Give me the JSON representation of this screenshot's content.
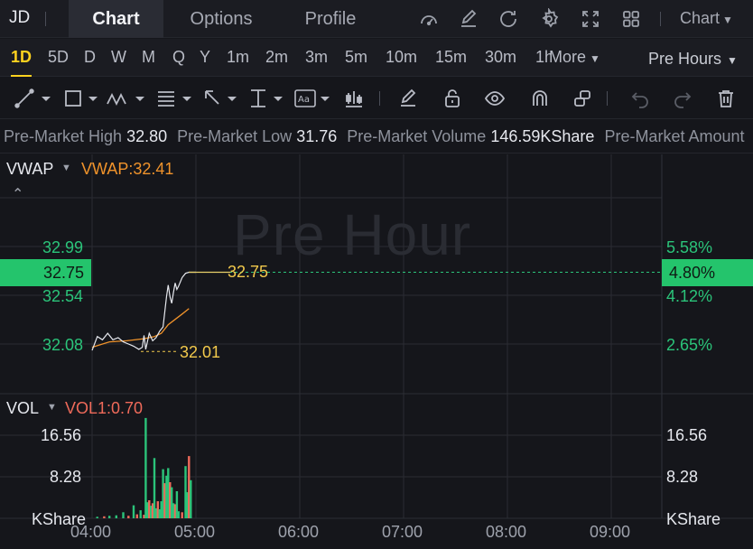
{
  "header": {
    "symbol": "JD",
    "tabs": [
      {
        "label": "Chart",
        "active": true
      },
      {
        "label": "Options",
        "active": false
      },
      {
        "label": "Profile",
        "active": false
      }
    ],
    "icons": [
      "gauge-icon",
      "edit-icon",
      "refresh-icon",
      "settings-icon",
      "fullscreen-icon",
      "layout-grid-icon"
    ],
    "chart_menu": "Chart"
  },
  "timeframes": {
    "items": [
      "1D",
      "5D",
      "D",
      "W",
      "M",
      "Q",
      "Y",
      "1m",
      "2m",
      "3m",
      "5m",
      "10m",
      "15m",
      "30m",
      "1h"
    ],
    "active": "1D",
    "more": "More",
    "session": "Pre Hours"
  },
  "ticker": [
    {
      "label": "Pre-Market High",
      "value": "32.80"
    },
    {
      "label": "Pre-Market Low",
      "value": "31.76"
    },
    {
      "label": "Pre-Market Volume",
      "value": "146.59KShare"
    },
    {
      "label": "Pre-Market Amount",
      "value": ""
    }
  ],
  "price_panel": {
    "indicator": "VWAP",
    "indicator_value": "VWAP:32.41",
    "watermark": "Pre Hour",
    "left_ticks": [
      "32.99",
      "32.54",
      "32.08"
    ],
    "right_ticks": [
      "5.58%",
      "4.12%",
      "2.65%"
    ],
    "current_price": "32.75",
    "current_pct": "4.80%",
    "last_label": "32.75",
    "low_label": "32.01"
  },
  "volume_panel": {
    "indicator": "VOL",
    "indicator_value": "VOL1:0.70",
    "left_ticks": [
      "16.56",
      "8.28",
      "KShare"
    ],
    "right_ticks": [
      "16.56",
      "8.28",
      "KShare"
    ]
  },
  "x_axis": [
    "04:00",
    "05:00",
    "06:00",
    "07:00",
    "08:00",
    "09:00"
  ],
  "colors": {
    "up": "#2bc47a",
    "down": "#ef6a5a",
    "accent": "#ffd21f",
    "vwap": "#f0932b",
    "price_line": "#e6e8ee"
  },
  "chart_data": {
    "type": "line",
    "x_range": [
      "04:00",
      "09:30"
    ],
    "y_range": [
      31.76,
      33.2
    ],
    "price": [
      {
        "t": "04:00",
        "p": 32.02
      },
      {
        "t": "04:03",
        "p": 32.15
      },
      {
        "t": "04:06",
        "p": 32.12
      },
      {
        "t": "04:09",
        "p": 32.18
      },
      {
        "t": "04:12",
        "p": 32.12
      },
      {
        "t": "04:15",
        "p": 32.14
      },
      {
        "t": "04:18",
        "p": 32.1
      },
      {
        "t": "04:21",
        "p": 32.08
      },
      {
        "t": "04:24",
        "p": 32.06
      },
      {
        "t": "04:27",
        "p": 32.03
      },
      {
        "t": "04:29",
        "p": 32.05
      },
      {
        "t": "04:30",
        "p": 32.16
      },
      {
        "t": "04:31",
        "p": 32.03
      },
      {
        "t": "04:33",
        "p": 32.18
      },
      {
        "t": "04:35",
        "p": 32.11
      },
      {
        "t": "04:37",
        "p": 32.14
      },
      {
        "t": "04:39",
        "p": 32.2
      },
      {
        "t": "04:41",
        "p": 32.24
      },
      {
        "t": "04:42",
        "p": 32.38
      },
      {
        "t": "04:43",
        "p": 32.52
      },
      {
        "t": "04:44",
        "p": 32.63
      },
      {
        "t": "04:45",
        "p": 32.52
      },
      {
        "t": "04:46",
        "p": 32.46
      },
      {
        "t": "04:47",
        "p": 32.56
      },
      {
        "t": "04:48",
        "p": 32.65
      },
      {
        "t": "04:49",
        "p": 32.59
      },
      {
        "t": "04:50",
        "p": 32.62
      },
      {
        "t": "04:52",
        "p": 32.7
      },
      {
        "t": "04:54",
        "p": 32.74
      },
      {
        "t": "04:56",
        "p": 32.75
      },
      {
        "t": "05:00",
        "p": 32.75
      },
      {
        "t": "05:20",
        "p": 32.75
      }
    ],
    "vwap": [
      {
        "t": "04:00",
        "p": 32.05
      },
      {
        "t": "04:10",
        "p": 32.1
      },
      {
        "t": "04:20",
        "p": 32.11
      },
      {
        "t": "04:30",
        "p": 32.13
      },
      {
        "t": "04:36",
        "p": 32.15
      },
      {
        "t": "04:40",
        "p": 32.18
      },
      {
        "t": "04:44",
        "p": 32.26
      },
      {
        "t": "04:48",
        "p": 32.31
      },
      {
        "t": "04:52",
        "p": 32.36
      },
      {
        "t": "04:56",
        "p": 32.41
      }
    ],
    "volume": [
      {
        "t": "04:03",
        "v": 0.3,
        "up": true
      },
      {
        "t": "04:07",
        "v": 0.4,
        "up": false
      },
      {
        "t": "04:10",
        "v": 0.5,
        "up": true
      },
      {
        "t": "04:14",
        "v": 0.6,
        "up": true
      },
      {
        "t": "04:18",
        "v": 1.2,
        "up": true
      },
      {
        "t": "04:21",
        "v": 0.5,
        "up": false
      },
      {
        "t": "04:24",
        "v": 2.6,
        "up": true
      },
      {
        "t": "04:26",
        "v": 0.8,
        "up": false
      },
      {
        "t": "04:28",
        "v": 1.6,
        "up": true
      },
      {
        "t": "04:30",
        "v": 0.7,
        "up": false
      },
      {
        "t": "04:31",
        "v": 22.0,
        "up": true
      },
      {
        "t": "04:32",
        "v": 3.2,
        "up": true
      },
      {
        "t": "04:33",
        "v": 3.6,
        "up": false
      },
      {
        "t": "04:34",
        "v": 2.5,
        "up": true
      },
      {
        "t": "04:35",
        "v": 3.0,
        "up": false
      },
      {
        "t": "04:36",
        "v": 12.0,
        "up": true
      },
      {
        "t": "04:37",
        "v": 2.0,
        "up": true
      },
      {
        "t": "04:38",
        "v": 3.4,
        "up": false
      },
      {
        "t": "04:39",
        "v": 1.8,
        "up": true
      },
      {
        "t": "04:40",
        "v": 3.4,
        "up": true
      },
      {
        "t": "04:41",
        "v": 9.8,
        "up": true
      },
      {
        "t": "04:42",
        "v": 7.0,
        "up": false
      },
      {
        "t": "04:43",
        "v": 8.5,
        "up": true
      },
      {
        "t": "04:44",
        "v": 10.0,
        "up": true
      },
      {
        "t": "04:45",
        "v": 7.2,
        "up": false
      },
      {
        "t": "04:46",
        "v": 6.2,
        "up": true
      },
      {
        "t": "04:47",
        "v": 3.0,
        "up": true
      },
      {
        "t": "04:48",
        "v": 2.8,
        "up": false
      },
      {
        "t": "04:49",
        "v": 5.4,
        "up": true
      },
      {
        "t": "04:50",
        "v": 1.4,
        "up": true
      },
      {
        "t": "04:52",
        "v": 1.2,
        "up": false
      },
      {
        "t": "04:54",
        "v": 10.4,
        "up": true
      },
      {
        "t": "04:55",
        "v": 5.2,
        "up": true
      },
      {
        "t": "04:56",
        "v": 12.4,
        "up": false
      },
      {
        "t": "04:57",
        "v": 7.6,
        "up": true
      }
    ]
  }
}
